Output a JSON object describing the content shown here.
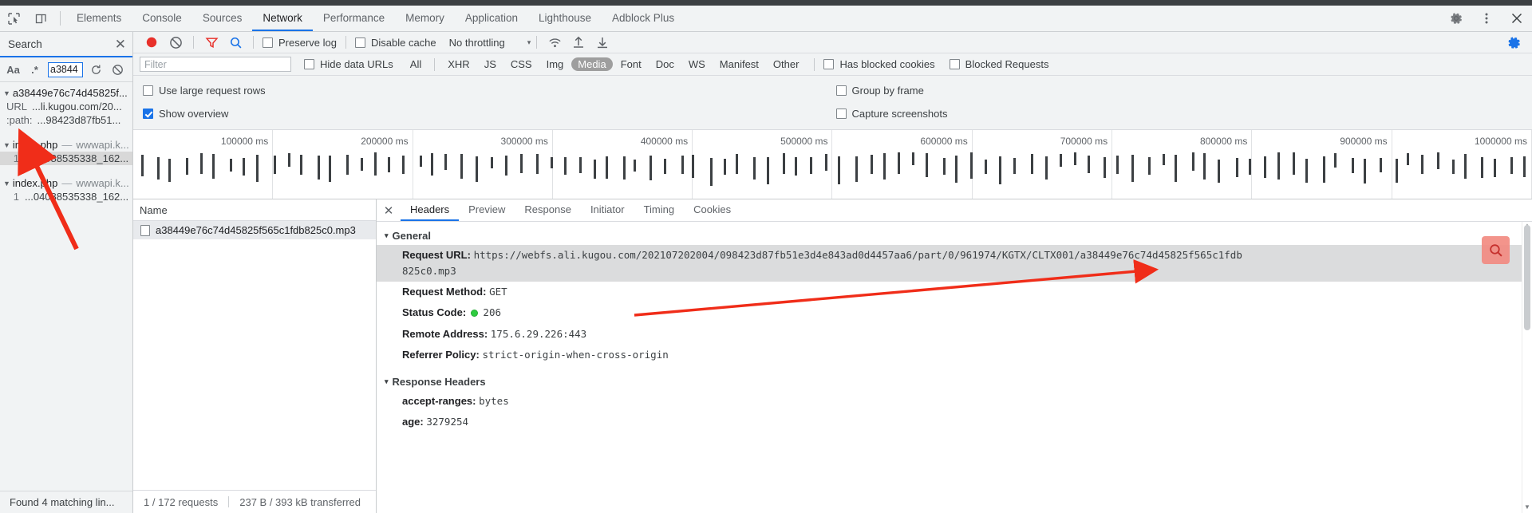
{
  "window": {
    "tabs": [
      {
        "label": "Elements",
        "active": false
      },
      {
        "label": "Console",
        "active": false
      },
      {
        "label": "Sources",
        "active": false
      },
      {
        "label": "Network",
        "active": true
      },
      {
        "label": "Performance",
        "active": false
      },
      {
        "label": "Memory",
        "active": false
      },
      {
        "label": "Application",
        "active": false
      },
      {
        "label": "Lighthouse",
        "active": false
      },
      {
        "label": "Adblock Plus",
        "active": false
      }
    ],
    "icons": {
      "inspect": "inspect-element-icon",
      "device": "device-toolbar-icon",
      "settings": "gear-icon",
      "more": "kebab-menu-icon",
      "close": "close-icon"
    }
  },
  "search": {
    "title": "Search",
    "close": "✕",
    "match_case_label": "Aa",
    "regex_label": ".*",
    "query": "a3844",
    "refresh_icon": "refresh-icon",
    "clear_icon": "clear-icon",
    "status": "Found 4 matching lin...",
    "results": [
      {
        "type": "group",
        "title": "a38449e76c74d45825f...",
        "host": "",
        "rows": [
          {
            "key": "URL",
            "value": "...li.kugou.com/20...",
            "selected": false
          },
          {
            "key": ":path:",
            "value": "...98423d87fb51...",
            "selected": false
          }
        ]
      },
      {
        "type": "group",
        "title": "index.php",
        "host": "wwwapi.k...",
        "rows": [
          {
            "line": "1",
            "value": "...04088535338_162...",
            "selected": true
          }
        ]
      },
      {
        "type": "group",
        "title": "index.php",
        "host": "wwwapi.k...",
        "rows": [
          {
            "line": "1",
            "value": "...04088535338_162...",
            "selected": false
          }
        ]
      }
    ]
  },
  "network_toolbar": {
    "record_icon": "record-stop-icon",
    "clear_icon": "clear-network-icon",
    "filter_icon": "filter-funnel-icon",
    "search_icon": "search-icon",
    "preserve_log": {
      "label": "Preserve log",
      "checked": false
    },
    "disable_cache": {
      "label": "Disable cache",
      "checked": false
    },
    "throttling": "No throttling",
    "throttle_chevron": "▾",
    "wifi_icon": "network-conditions-icon",
    "import_icon": "import-har-icon",
    "export_icon": "export-har-icon",
    "settings_icon": "gear-icon"
  },
  "filter_bar": {
    "placeholder": "Filter",
    "value": "",
    "hide_data_urls": {
      "label": "Hide data URLs",
      "checked": false
    },
    "types": [
      {
        "label": "All",
        "active": false
      },
      {
        "label": "XHR",
        "active": false
      },
      {
        "label": "JS",
        "active": false
      },
      {
        "label": "CSS",
        "active": false
      },
      {
        "label": "Img",
        "active": false
      },
      {
        "label": "Media",
        "active": true
      },
      {
        "label": "Font",
        "active": false
      },
      {
        "label": "Doc",
        "active": false
      },
      {
        "label": "WS",
        "active": false
      },
      {
        "label": "Manifest",
        "active": false
      },
      {
        "label": "Other",
        "active": false
      }
    ],
    "has_blocked_cookies": {
      "label": "Has blocked cookies",
      "checked": false
    },
    "blocked_requests": {
      "label": "Blocked Requests",
      "checked": false
    }
  },
  "options_bar": {
    "use_large_request_rows": {
      "label": "Use large request rows",
      "checked": false
    },
    "group_by_frame": {
      "label": "Group by frame",
      "checked": false
    },
    "show_overview": {
      "label": "Show overview",
      "checked": true
    },
    "capture_screenshots": {
      "label": "Capture screenshots",
      "checked": false
    }
  },
  "overview": {
    "ticks": [
      "100000 ms",
      "200000 ms",
      "300000 ms",
      "400000 ms",
      "500000 ms",
      "600000 ms",
      "700000 ms",
      "800000 ms",
      "900000 ms",
      "1000000 ms"
    ]
  },
  "request_list": {
    "column_header": "Name",
    "rows": [
      {
        "name": "a38449e76c74d45825f565c1fdb825c0.mp3",
        "selected": true
      }
    ],
    "status": {
      "requests": "1 / 172 requests",
      "transferred": "237 B / 393 kB transferred"
    }
  },
  "detail": {
    "close_icon": "✕",
    "tabs": [
      {
        "label": "Headers",
        "active": true
      },
      {
        "label": "Preview",
        "active": false
      },
      {
        "label": "Response",
        "active": false
      },
      {
        "label": "Initiator",
        "active": false
      },
      {
        "label": "Timing",
        "active": false
      },
      {
        "label": "Cookies",
        "active": false
      }
    ],
    "general": {
      "title": "General",
      "caret": "▾",
      "rows": [
        {
          "key": "Request URL:",
          "value": "https://webfs.ali.kugou.com/202107202004/098423d87fb51e3d4e843ad0d4457aa6/part/0/961974/KGTX/CLTX001/a38449e76c74d45825f565c1fdb825c0.mp3",
          "highlight": true
        },
        {
          "key": "Request Method:",
          "value": "GET",
          "highlight": false
        },
        {
          "key": "Status Code:",
          "value": "206",
          "status_dot": true,
          "highlight": false
        },
        {
          "key": "Remote Address:",
          "value": "175.6.29.226:443",
          "highlight": false
        },
        {
          "key": "Referrer Policy:",
          "value": "strict-origin-when-cross-origin",
          "highlight": false
        }
      ]
    },
    "response_headers": {
      "title": "Response Headers",
      "caret": "▾",
      "rows": [
        {
          "key": "accept-ranges:",
          "value": "bytes"
        },
        {
          "key": "age:",
          "value": "3279254"
        }
      ]
    },
    "find_chip_icon": "search-icon"
  },
  "colors": {
    "accent": "#1a73e8",
    "record": "#e8302a",
    "active_chip": "#9e9e9e",
    "status_ok": "#2ecc40",
    "annotation": "#f02d19"
  }
}
